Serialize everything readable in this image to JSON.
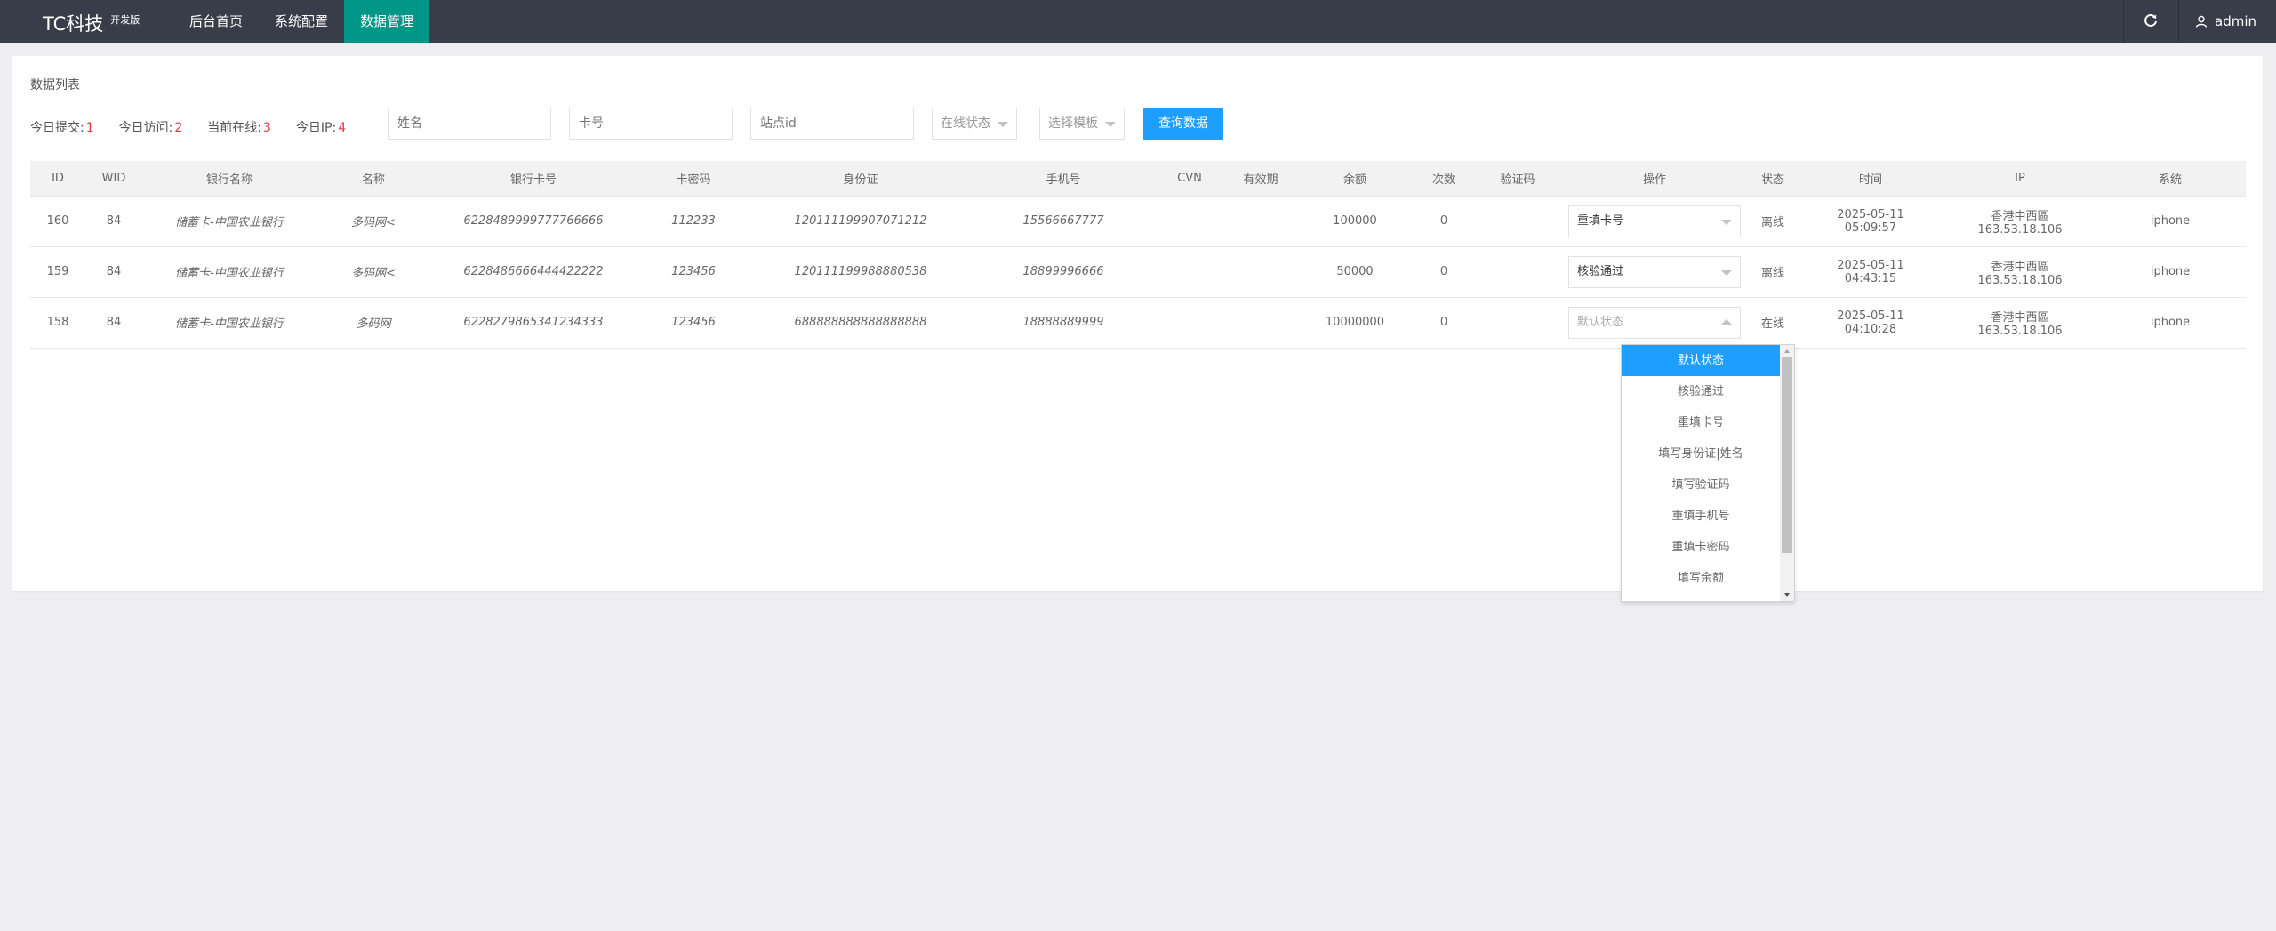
{
  "header": {
    "logo": "TC科技",
    "logo_sup": "开发版",
    "nav": [
      "后台首页",
      "系统配置",
      "数据管理"
    ],
    "user": "admin",
    "refresh_icon": "refresh-icon",
    "user_icon": "user-icon"
  },
  "panel": {
    "title": "数据列表",
    "stats": [
      {
        "label": "今日提交:",
        "value": "1"
      },
      {
        "label": "今日访问:",
        "value": "2"
      },
      {
        "label": "当前在线:",
        "value": "3"
      },
      {
        "label": "今日IP:",
        "value": "4"
      }
    ],
    "filters": {
      "name_placeholder": "姓名",
      "card_placeholder": "卡号",
      "site_placeholder": "站点id",
      "online_select": "在线状态",
      "template_select": "选择模板",
      "query_button": "查询数据"
    }
  },
  "table": {
    "headers": [
      "ID",
      "WID",
      "银行名称",
      "名称",
      "银行卡号",
      "卡密码",
      "身份证",
      "手机号",
      "CVN",
      "有效期",
      "余额",
      "次数",
      "验证码",
      "操作",
      "状态",
      "时间",
      "IP",
      "系统"
    ],
    "rows": [
      {
        "id": "160",
        "wid": "84",
        "bank": "储蓄卡-中国农业银行",
        "name": "多码网<",
        "card": "6228489999777766666",
        "pwd": "112233",
        "idno": "120111199907071212",
        "phone": "15566667777",
        "cvn": "",
        "exp": "",
        "balance": "100000",
        "count": "0",
        "code": "",
        "op": "重填卡号",
        "status": "离线",
        "date": "2025-05-11",
        "time": "05:09:57",
        "ip_loc": "香港中西區",
        "ip": "163.53.18.106",
        "sys": "iphone"
      },
      {
        "id": "159",
        "wid": "84",
        "bank": "储蓄卡-中国农业银行",
        "name": "多码网<",
        "card": "6228486666444422222",
        "pwd": "123456",
        "idno": "120111199988880538",
        "phone": "18899996666",
        "cvn": "",
        "exp": "",
        "balance": "50000",
        "count": "0",
        "code": "",
        "op": "核验通过",
        "status": "离线",
        "date": "2025-05-11",
        "time": "04:43:15",
        "ip_loc": "香港中西區",
        "ip": "163.53.18.106",
        "sys": "iphone"
      },
      {
        "id": "158",
        "wid": "84",
        "bank": "储蓄卡-中国农业银行",
        "name": "多码网",
        "card": "6228279865341234333",
        "pwd": "123456",
        "idno": "688888888888888888",
        "phone": "18888889999",
        "cvn": "",
        "exp": "",
        "balance": "10000000",
        "count": "0",
        "code": "",
        "op": "默认状态",
        "status": "在线",
        "date": "2025-05-11",
        "time": "04:10:28",
        "ip_loc": "香港中西區",
        "ip": "163.53.18.106",
        "sys": "iphone"
      }
    ]
  },
  "dropdown": {
    "options": [
      "默认状态",
      "核验通过",
      "重填卡号",
      "填写身份证|姓名",
      "填写验证码",
      "重填手机号",
      "重填卡密码",
      "填写余额"
    ],
    "selected": "默认状态"
  }
}
